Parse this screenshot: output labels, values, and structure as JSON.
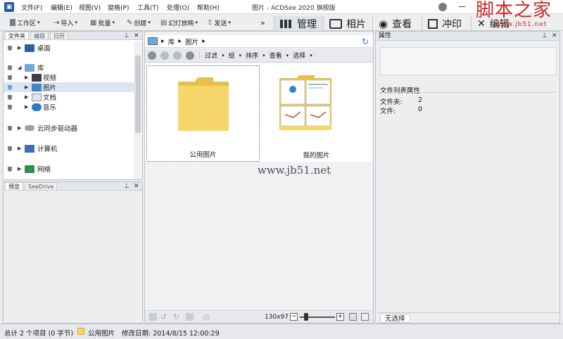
{
  "app": {
    "window_title": "图片 - ACDSee 2020 旗舰版",
    "menu": [
      "文件(F)",
      "编辑(E)",
      "视图(V)",
      "窗格(P)",
      "工具(T)",
      "处理(O)",
      "帮助(H)"
    ]
  },
  "watermark": {
    "logo": "脚本之家",
    "logo_url": "www.jb51.net",
    "center": "www.jb51.net"
  },
  "toolbar": {
    "buttons": [
      "工作区",
      "导入",
      "批量",
      "创建",
      "幻灯放映",
      "发送"
    ],
    "more": "»",
    "modes": [
      "管理",
      "相片",
      "查看",
      "冲印",
      "编辑"
    ]
  },
  "left_panel": {
    "tabs": [
      "文件夹",
      "编目",
      "日历"
    ],
    "tree": {
      "desktop": "桌面",
      "library": "库",
      "video": "视频",
      "pictures": "图片",
      "documents": "文档",
      "music": "音乐",
      "cloud": "云同步驱动器",
      "computer": "计算机",
      "network": "网络"
    },
    "preview_tabs": [
      "预览",
      "SeeDrive"
    ]
  },
  "center": {
    "breadcrumb": [
      "库",
      "图片"
    ],
    "filter_items": [
      "过滤",
      "组",
      "排序",
      "查看",
      "选择"
    ],
    "tiles": [
      {
        "label": "公用图片"
      },
      {
        "label": "我的图片"
      }
    ],
    "zoom": "130x97"
  },
  "right_panel": {
    "title": "属性",
    "section_title": "文件列表属性",
    "rows": [
      {
        "label": "文件夹:",
        "value": "2"
      },
      {
        "label": "文件:",
        "value": "0"
      }
    ],
    "tab": "无选择"
  },
  "statusbar": {
    "summary": "总计 2 个项目 (0 字节)",
    "folder": "公用图片",
    "modified": "修改日期: 2014/8/15 12:00:29"
  },
  "colors": {
    "folder_yellow": "#f6d56a",
    "accent_blue": "#1f5aa6",
    "logo_red": "#c82828"
  }
}
